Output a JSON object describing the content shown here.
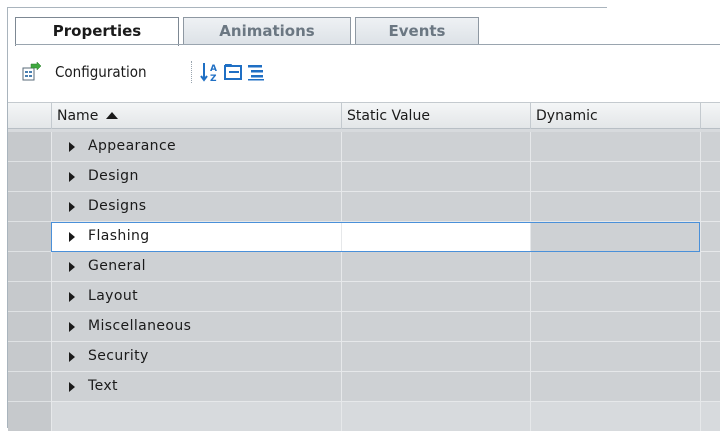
{
  "tabs": [
    {
      "label": "Properties",
      "active": true
    },
    {
      "label": "Animations",
      "active": false
    },
    {
      "label": "Events",
      "active": false
    }
  ],
  "toolbar": {
    "configuration_label": "Configuration",
    "icons": [
      "configuration-icon",
      "sort-alphabetical-icon",
      "categorized-view-icon",
      "expand-all-icon"
    ]
  },
  "grid": {
    "columns": [
      "Name",
      "Static Value",
      "Dynamic"
    ],
    "sort_column": "Name",
    "sort_direction": "ascending",
    "rows": [
      "Appearance",
      "Design",
      "Designs",
      "Flashing",
      "General",
      "Layout",
      "Miscellaneous",
      "Security",
      "Text"
    ],
    "selected_row": "Flashing"
  },
  "colors": {
    "selection_border": "#4a90d9",
    "row_background": "#ced1d4",
    "selected_background": "#ffffff"
  }
}
